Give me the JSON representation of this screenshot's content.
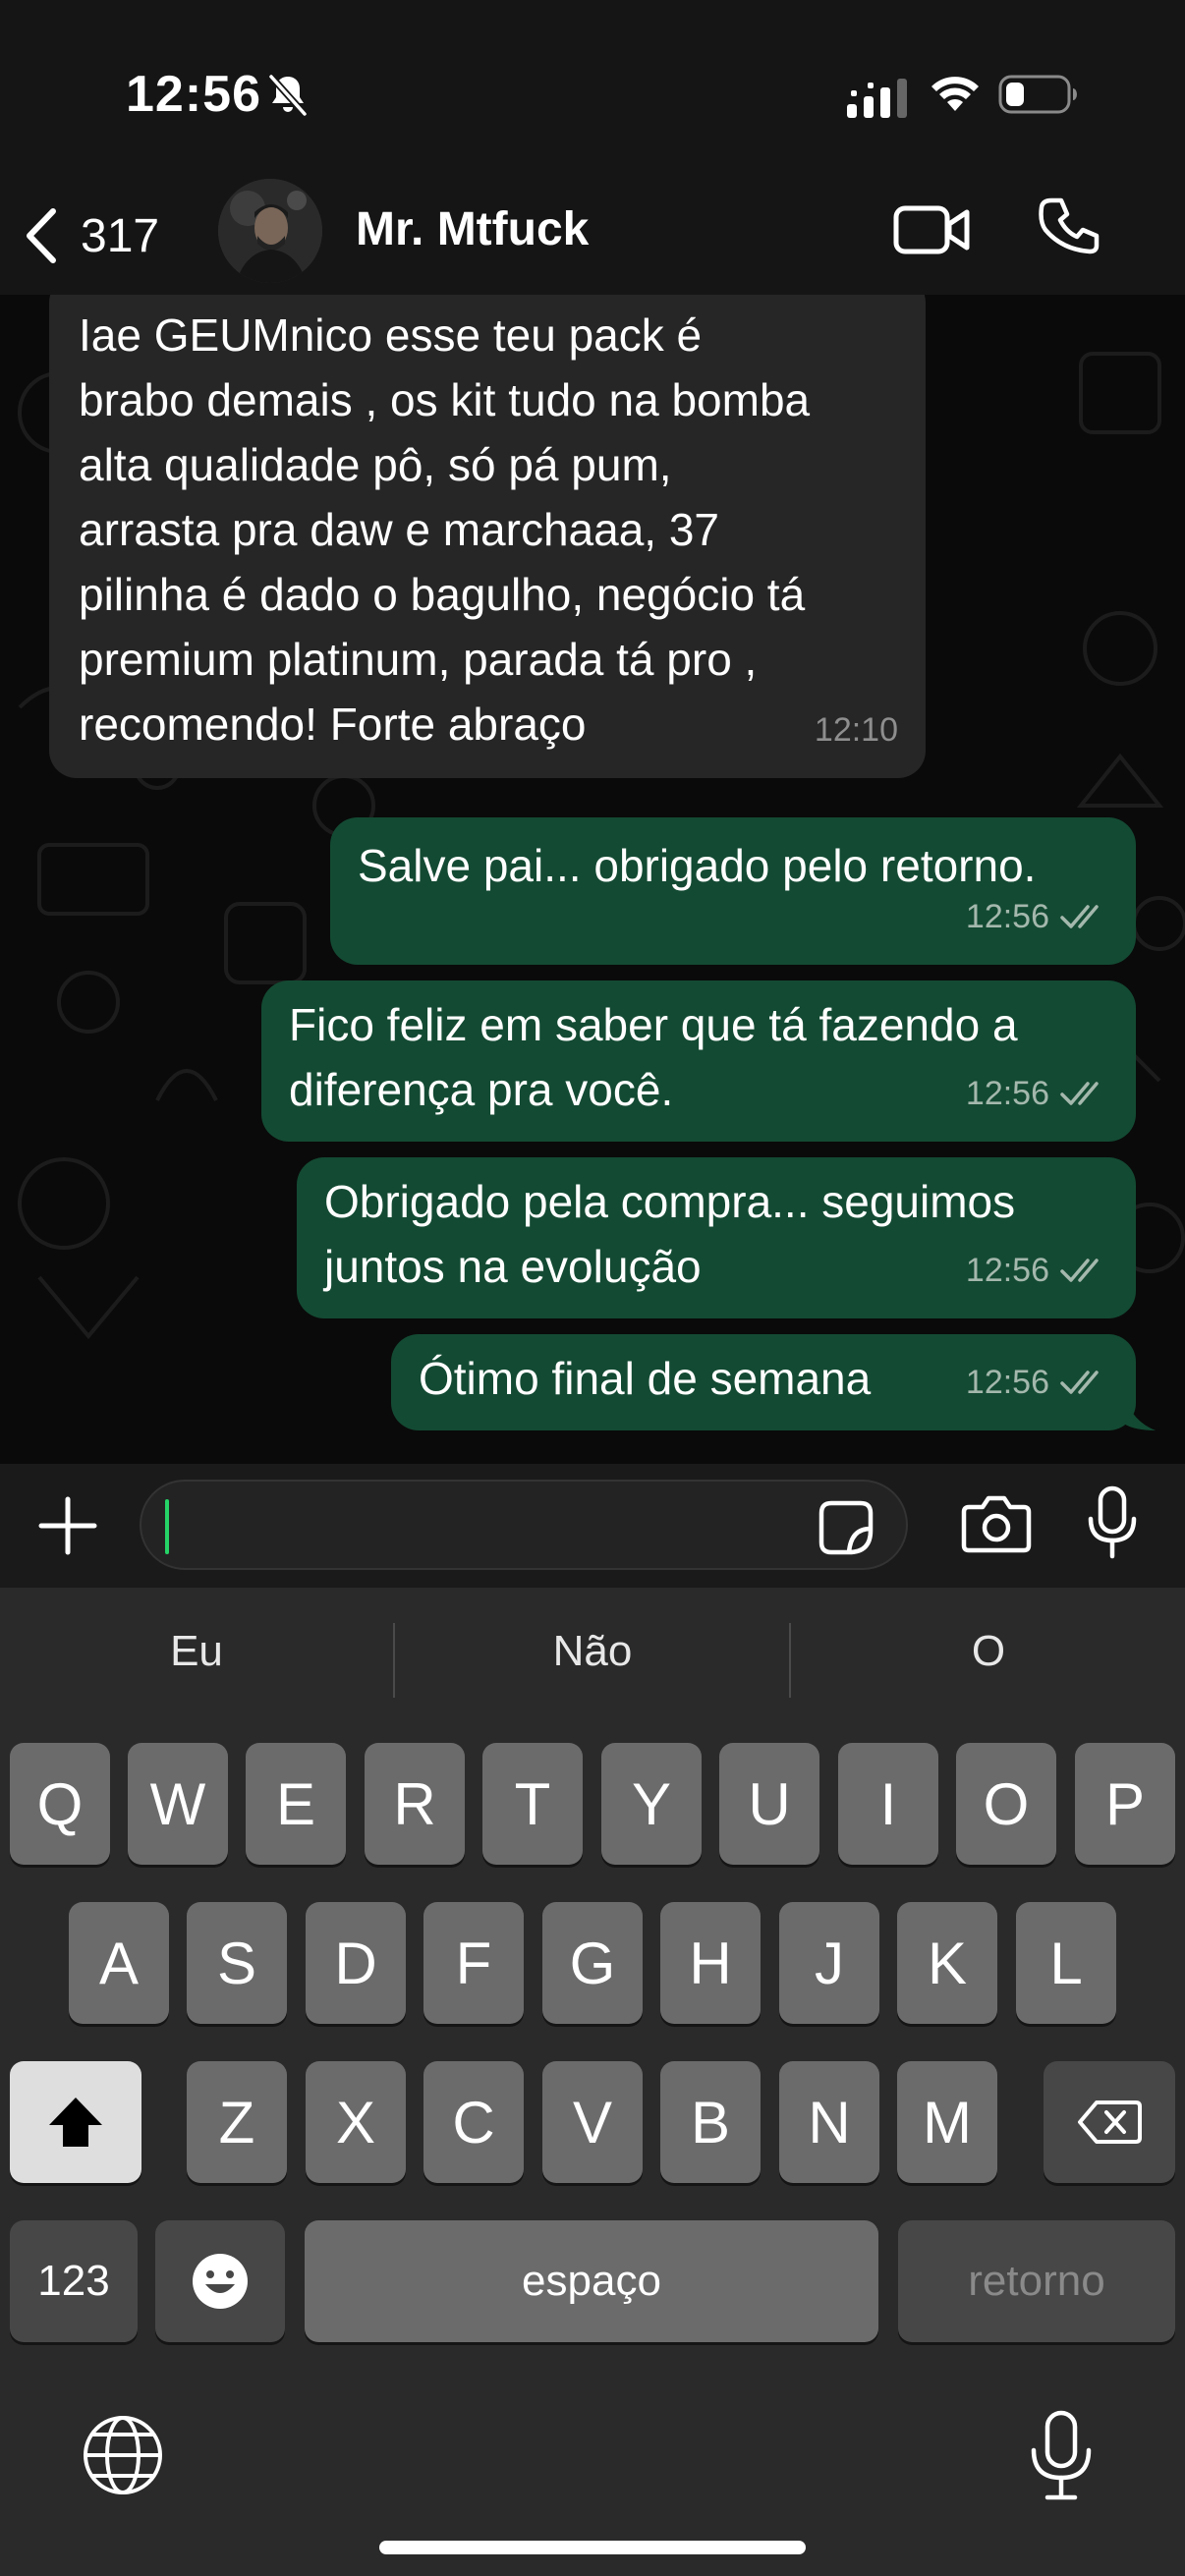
{
  "status_bar": {
    "time": "12:56",
    "icons": [
      "bell-slash-icon",
      "cellular-signal-icon",
      "wifi-icon",
      "battery-icon"
    ]
  },
  "header": {
    "back_count": "317",
    "contact_name": "Mr. Mtfuck",
    "icons": [
      "chevron-left-icon",
      "video-camera-icon",
      "phone-icon"
    ]
  },
  "messages": [
    {
      "direction": "incoming",
      "text": "Iae GEUMnico esse teu pack é\nbrabo demais , os kit tudo na bomba\nalta qualidade pô, só pá pum,\narrasta pra daw e marchaaa, 37\npilinha é dado o bagulho, negócio tá\npremium platinum, parada tá pro ,\nrecomendo! Forte abraço",
      "time": "12:10"
    },
    {
      "direction": "outgoing",
      "text": "Salve pai... obrigado pelo retorno.",
      "time": "12:56",
      "status": "read"
    },
    {
      "direction": "outgoing",
      "text": "Fico feliz em saber que tá fazendo a\ndiferença pra você.",
      "time": "12:56",
      "status": "read"
    },
    {
      "direction": "outgoing",
      "text": "Obrigado pela compra... seguimos\njuntos na evolução",
      "time": "12:56",
      "status": "read"
    },
    {
      "direction": "outgoing",
      "text": "Ótimo final de semana",
      "time": "12:56",
      "status": "read"
    }
  ],
  "composer": {
    "value": "",
    "icons": [
      "plus-icon",
      "sticker-icon",
      "camera-icon",
      "microphone-icon"
    ]
  },
  "keyboard": {
    "suggestions": [
      "Eu",
      "Não",
      "O"
    ],
    "row1": [
      "Q",
      "W",
      "E",
      "R",
      "T",
      "Y",
      "U",
      "I",
      "O",
      "P"
    ],
    "row2": [
      "A",
      "S",
      "D",
      "F",
      "G",
      "H",
      "J",
      "K",
      "L"
    ],
    "row3": [
      "Z",
      "X",
      "C",
      "V",
      "B",
      "N",
      "M"
    ],
    "numbers_key": "123",
    "space_key": "espaço",
    "return_key": "retorno"
  },
  "colors": {
    "outgoing_bubble": "#134a33",
    "incoming_bubble": "#262626",
    "caret": "#25d366"
  }
}
